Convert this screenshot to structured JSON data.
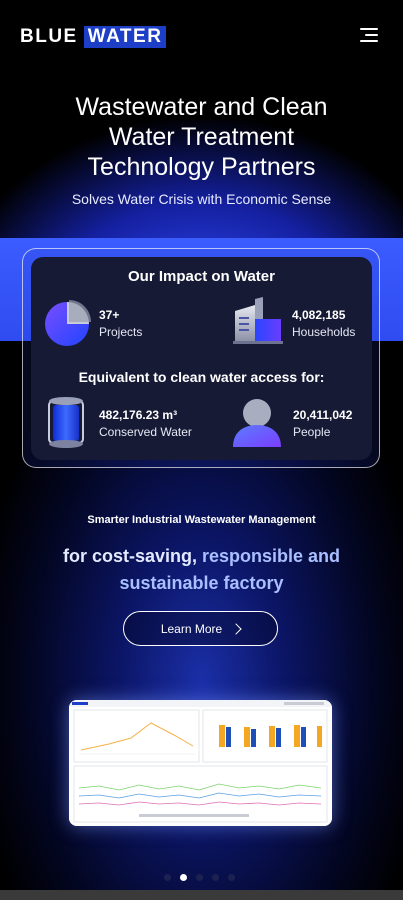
{
  "header": {
    "logo_part1": "BLUE",
    "logo_part2": "WATER",
    "menu_icon": "hamburger-menu-icon"
  },
  "hero": {
    "title_line1": "Wastewater and Clean",
    "title_line2": "Water Treatment",
    "title_line3": "Technology Partners",
    "subtitle": "Solves Water Crisis with Economic Sense"
  },
  "impact": {
    "title": "Our Impact on Water",
    "projects": {
      "value": "37+",
      "label": "Projects",
      "icon": "pie-chart-icon"
    },
    "households": {
      "value": "4,082,185",
      "label": "Households",
      "icon": "building-icon"
    },
    "equivalent_title": "Equivalent to clean water access for:",
    "water": {
      "value": "482,176.23 m³",
      "label": "Conserved Water",
      "icon": "water-cylinder-icon"
    },
    "people": {
      "value": "20,411,042",
      "label": "People",
      "icon": "person-icon"
    }
  },
  "section2": {
    "kicker": "Smarter Industrial Wastewater Management",
    "title_part1": "for cost-saving, ",
    "title_part2": "responsible and sustainable factory",
    "button_label": "Learn More",
    "button_icon": "chevron-right-icon"
  },
  "carousel": {
    "active_index": 1,
    "count": 5
  },
  "colors": {
    "brand_blue": "#1d3fc8",
    "accent_light": "#aabfff",
    "card_bg": "#161a35"
  }
}
